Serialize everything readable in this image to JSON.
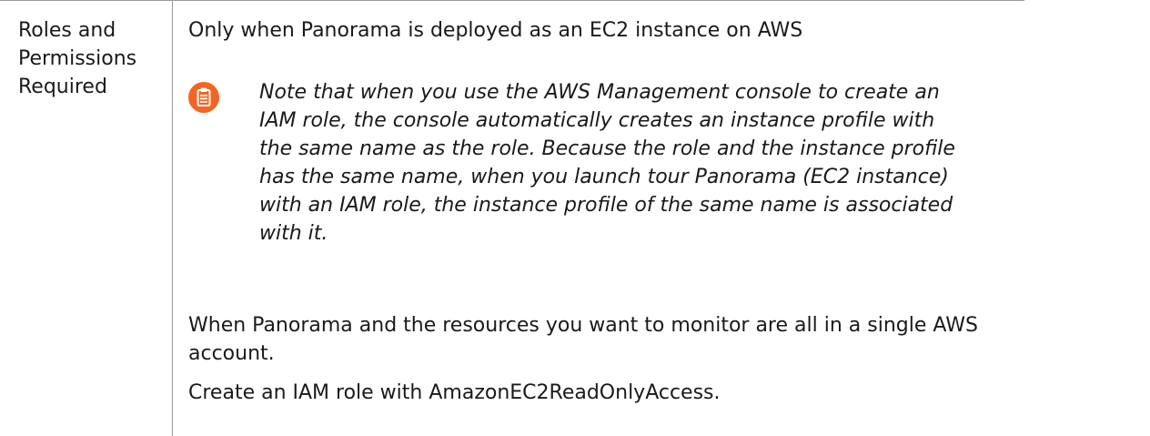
{
  "row_header": {
    "lines": [
      "Roles and",
      "Permissions",
      "Required"
    ]
  },
  "content": {
    "intro": "Only when Panorama is deployed as an EC2 instance on AWS",
    "note": {
      "icon": "clipboard-note-icon",
      "icon_color": "#f26522",
      "lines": [
        "Note that when you use the AWS Management console to create an",
        "IAM role, the console automatically creates an instance profile with",
        "the same name as the role. Because the role and the instance profile",
        "has the same name, when you launch tour Panorama (EC2 instance)",
        "with an IAM role, the instance profile of the same name is associated",
        "with it."
      ]
    },
    "condition_lines": [
      "When Panorama and the resources you want to monitor are all in a single AWS",
      "account."
    ],
    "action": "Create an IAM role with AmazonEC2ReadOnlyAccess."
  }
}
